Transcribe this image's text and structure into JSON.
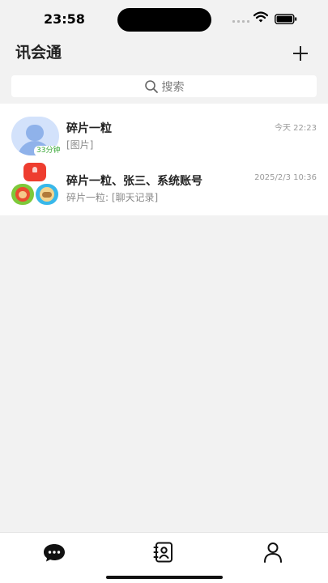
{
  "status_bar": {
    "time": "23:58",
    "signal": "cellular-signal-icon",
    "wifi": "wifi-icon",
    "battery": "battery-icon"
  },
  "header": {
    "title": "讯会通",
    "add_icon": "plus-icon"
  },
  "search": {
    "placeholder": "搜索",
    "icon": "search-icon"
  },
  "chats": [
    {
      "name": "碎片一粒",
      "preview": "[图片]",
      "time": "今天 22:23",
      "badge": "33分钟"
    },
    {
      "name": "碎片一粒、张三、系统账号",
      "preview": "碎片一粒: [聊天记录]",
      "time": "2025/2/3 10:36"
    }
  ],
  "tabs": [
    {
      "icon": "chat-bubble-icon",
      "active": true
    },
    {
      "icon": "contacts-book-icon",
      "active": false
    },
    {
      "icon": "person-icon",
      "active": false
    }
  ],
  "colors": {
    "background": "#f2f2f2",
    "badge_green": "#33a532",
    "avatar_blue": "#8fb2ea"
  }
}
